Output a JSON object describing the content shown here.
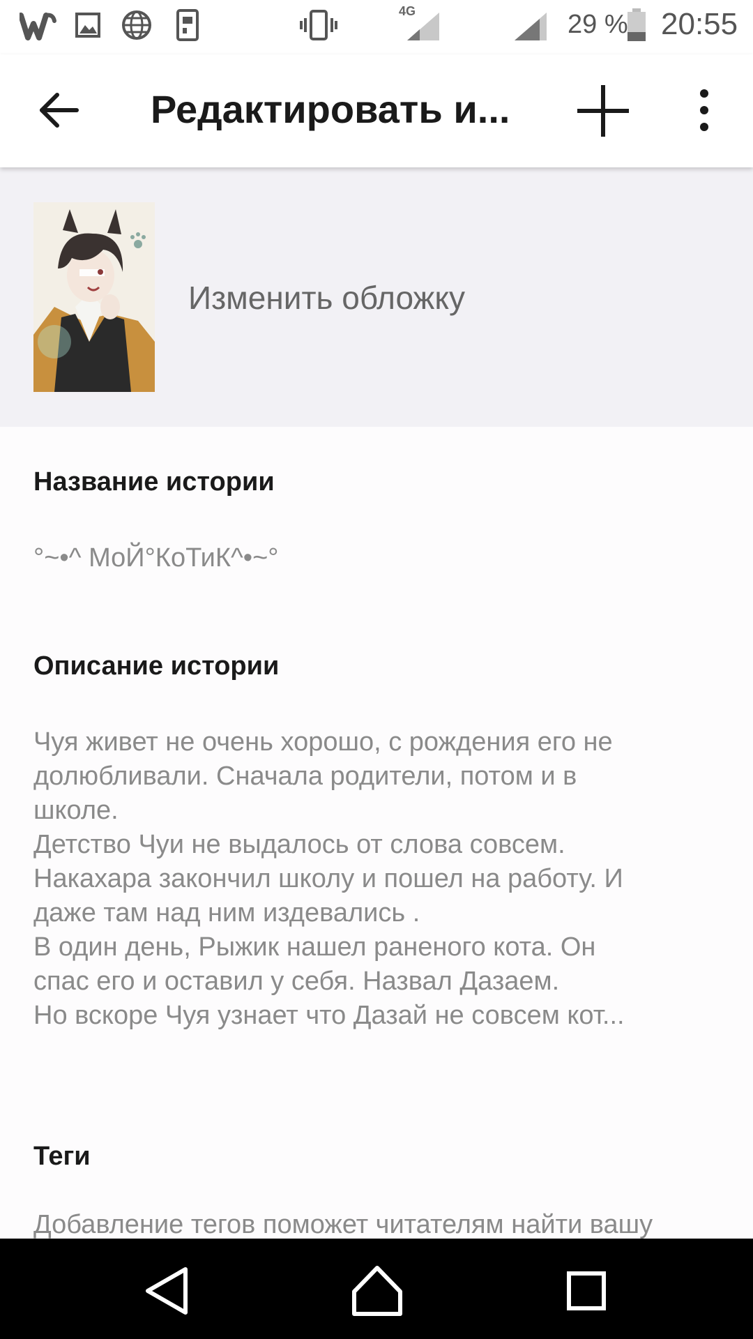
{
  "status_bar": {
    "network_label": "4G",
    "battery": "29 %",
    "time": "20:55"
  },
  "app_bar": {
    "title": "Редактировать и..."
  },
  "cover": {
    "change_label": "Изменить обложку"
  },
  "story": {
    "title_label": "Название истории",
    "title_value": "°~•^ МоЙ°КоТиК^•~°",
    "description_label": "Описание истории",
    "description_lines": [
      "Чуя живет не очень хорошо, с рождения его не",
      "долюбливали. Сначала родители, потом и  в",
      "школе.",
      "Детство Чуи не выдалось от слова совсем.",
      "Накахара закончил школу и пошел на работу. И",
      "даже там над ним издевались .",
      "В один день, Рыжик нашел раненого кота. Он",
      "спас его и оставил у себя. Назвал Дазаем.",
      "Но вскоре Чуя узнает что Дазай не совсем кот..."
    ],
    "tags_label": "Теги",
    "tags_hint": "Добавление тегов поможет читателям найти вашу"
  }
}
